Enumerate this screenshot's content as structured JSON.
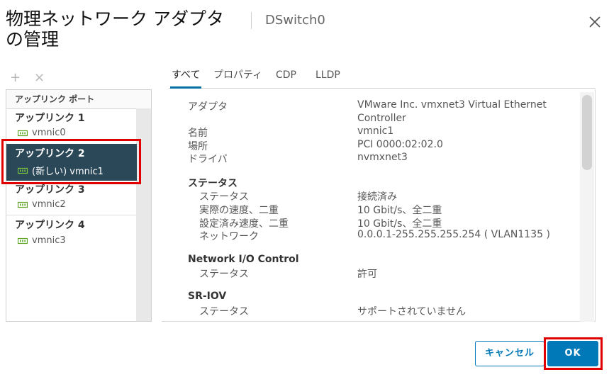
{
  "dialog": {
    "title": "物理ネットワーク アダプタの管理",
    "switch_name": "DSwitch0"
  },
  "toolbar": {
    "add_icon": "plus-icon",
    "remove_icon": "x-icon",
    "add_label": "+",
    "remove_label": "×"
  },
  "uplinks": {
    "header": "アップリンク ポート",
    "items": [
      {
        "name": "アップリンク 1",
        "nic": "vmnic0"
      },
      {
        "name": "アップリンク 2",
        "nic": "(新しい) vmnic1"
      },
      {
        "name": "アップリンク 3",
        "nic": "vmnic2"
      },
      {
        "name": "アップリンク 4",
        "nic": "vmnic3"
      }
    ]
  },
  "tabs": [
    "すべて",
    "プロパティ",
    "CDP",
    "LLDP"
  ],
  "details": {
    "adapter_label": "アダプタ",
    "adapter_value_line1": "VMware Inc. vmxnet3 Virtual Ethernet",
    "adapter_value_line2": "Controller",
    "name_label": "名前",
    "name_value": "vmnic1",
    "location_label": "場所",
    "location_value": "PCI 0000:02:02.0",
    "driver_label": "ドライバ",
    "driver_value": "nvmxnet3",
    "status_section": "ステータス",
    "status_label": "ステータス",
    "status_value": "接続済み",
    "actual_speed_label": "実際の速度、二重",
    "actual_speed_value": "10 Gbit/s、全二重",
    "configured_speed_label": "設定済み速度、二重",
    "configured_speed_value": "10 Gbit/s、全二重",
    "network_label": "ネットワーク",
    "network_value": "0.0.0.1-255.255.255.254 ( VLAN1135 )",
    "nioc_section": "Network I/O Control",
    "nioc_status_label": "ステータス",
    "nioc_status_value": "許可",
    "sriov_section": "SR-IOV",
    "sriov_status_label": "ステータス",
    "sriov_status_value": "サポートされていません"
  },
  "buttons": {
    "cancel": "キャンセル",
    "ok": "OK"
  },
  "colors": {
    "accent": "#0079b8",
    "selected_row": "#2b4859",
    "highlight": "#e00000",
    "nic_icon": "#5aa220"
  }
}
